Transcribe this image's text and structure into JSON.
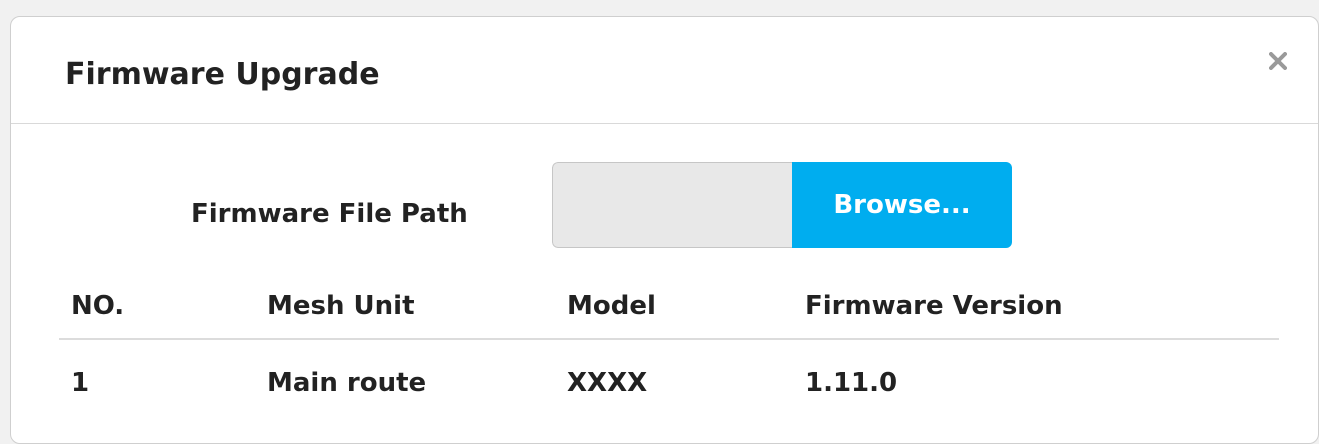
{
  "modal": {
    "title": "Firmware Upgrade",
    "close_label": "×"
  },
  "upload": {
    "label": "Firmware File Path",
    "file_path_value": "",
    "file_path_placeholder": "",
    "browse_label": "Browse..."
  },
  "table": {
    "columns": [
      "NO.",
      "Mesh Unit",
      "Model",
      "Firmware Version"
    ],
    "rows": [
      {
        "no": "1",
        "mesh_unit": "Main route",
        "model": "XXXX",
        "firmware_version": "1.11.0"
      }
    ]
  },
  "colors": {
    "accent": "#00adef",
    "input_background": "#e8e8e8",
    "text": "#222222",
    "close_icon": "#9a9a9a"
  },
  "icons": {
    "close": "close-icon"
  }
}
